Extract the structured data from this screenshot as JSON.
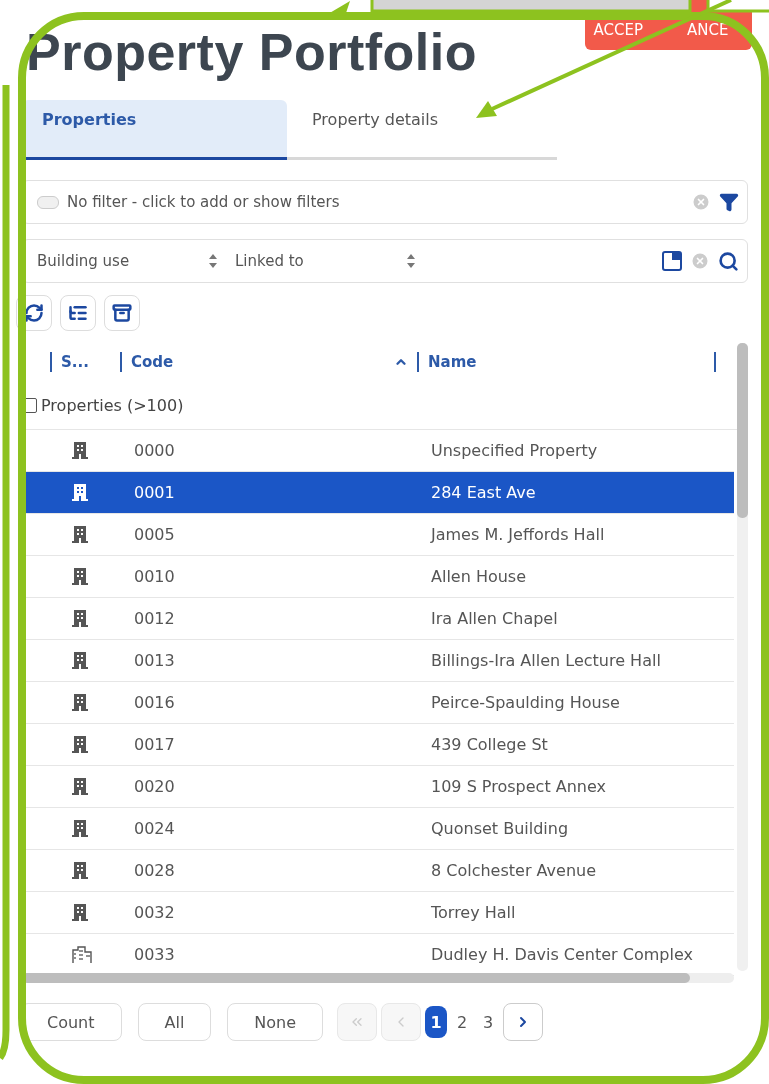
{
  "header": {
    "title": "Property Portfolio",
    "badge": [
      "ACCEP",
      "ANCE"
    ]
  },
  "tabs": [
    {
      "label": "Properties",
      "selected": true
    },
    {
      "label": "Property details",
      "selected": false
    }
  ],
  "filter_bar": {
    "text": "No filter - click to add or show filters",
    "toggle_on": false
  },
  "search_bar": {
    "fields": [
      "Building use",
      "Linked to"
    ]
  },
  "table": {
    "columns": [
      "S...",
      "Code",
      "Name"
    ],
    "group": {
      "label": "Properties (>100)",
      "checked": false
    },
    "rows": [
      {
        "kind": "building",
        "code": "0000",
        "name": "Unspecified Property",
        "selected": false
      },
      {
        "kind": "building",
        "code": "0001",
        "name": "284 East Ave",
        "selected": true
      },
      {
        "kind": "building",
        "code": "0005",
        "name": "James M. Jeffords Hall",
        "selected": false
      },
      {
        "kind": "building",
        "code": "0010",
        "name": "Allen House",
        "selected": false
      },
      {
        "kind": "building",
        "code": "0012",
        "name": "Ira Allen Chapel",
        "selected": false
      },
      {
        "kind": "building",
        "code": "0013",
        "name": "Billings-Ira Allen Lecture Hall",
        "selected": false
      },
      {
        "kind": "building",
        "code": "0016",
        "name": "Peirce-Spaulding House",
        "selected": false
      },
      {
        "kind": "building",
        "code": "0017",
        "name": "439 College St",
        "selected": false
      },
      {
        "kind": "building",
        "code": "0020",
        "name": "109 S Prospect Annex",
        "selected": false
      },
      {
        "kind": "building",
        "code": "0024",
        "name": "Quonset Building",
        "selected": false
      },
      {
        "kind": "building",
        "code": "0028",
        "name": "8 Colchester Avenue",
        "selected": false
      },
      {
        "kind": "building",
        "code": "0032",
        "name": "Torrey Hall",
        "selected": false
      },
      {
        "kind": "complex",
        "code": "0033",
        "name": "Dudley H. Davis Center Complex",
        "selected": false
      }
    ]
  },
  "footer": {
    "buttons": [
      "Count",
      "All",
      "None"
    ],
    "pager": [
      {
        "kind": "first",
        "disabled": true
      },
      {
        "kind": "prev",
        "disabled": true
      },
      {
        "kind": "page",
        "label": "1",
        "selected": true
      },
      {
        "kind": "page",
        "label": "2",
        "selected": false
      },
      {
        "kind": "page",
        "label": "3",
        "selected": false
      },
      {
        "kind": "next",
        "disabled": false
      }
    ]
  }
}
